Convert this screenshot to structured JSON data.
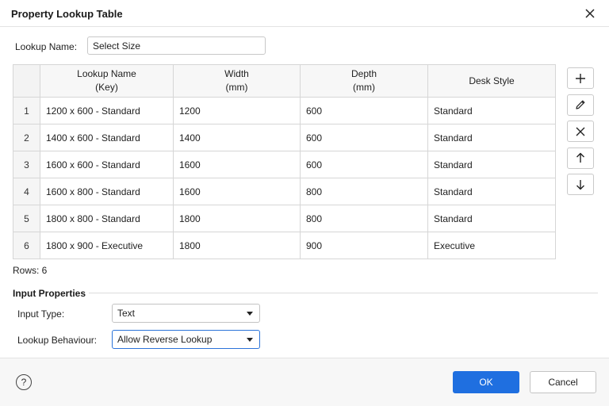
{
  "window": {
    "title": "Property Lookup Table"
  },
  "lookup_name": {
    "label": "Lookup Name:",
    "value": "Select Size"
  },
  "table": {
    "headers": [
      {
        "line1": "",
        "line2": ""
      },
      {
        "line1": "Lookup Name",
        "line2": "(Key)"
      },
      {
        "line1": "Width",
        "line2": "(mm)"
      },
      {
        "line1": "Depth",
        "line2": "(mm)"
      },
      {
        "line1": "Desk Style",
        "line2": ""
      }
    ],
    "rows": [
      {
        "num": "1",
        "key": "1200 x 600 - Standard",
        "width": "1200",
        "depth": "600",
        "style": "Standard"
      },
      {
        "num": "2",
        "key": "1400 x 600 - Standard",
        "width": "1400",
        "depth": "600",
        "style": "Standard"
      },
      {
        "num": "3",
        "key": "1600 x 600 - Standard",
        "width": "1600",
        "depth": "600",
        "style": "Standard"
      },
      {
        "num": "4",
        "key": "1600 x 800 - Standard",
        "width": "1600",
        "depth": "800",
        "style": "Standard"
      },
      {
        "num": "5",
        "key": "1800 x 800 - Standard",
        "width": "1800",
        "depth": "800",
        "style": "Standard"
      },
      {
        "num": "6",
        "key": "1800 x 900 - Executive",
        "width": "1800",
        "depth": "900",
        "style": "Executive"
      }
    ],
    "rows_count_label": "Rows: 6"
  },
  "side_toolbar": {
    "icons": [
      "add-icon",
      "edit-icon",
      "delete-icon",
      "move-up-icon",
      "move-down-icon"
    ]
  },
  "input_properties": {
    "section_title": "Input Properties",
    "input_type_label": "Input Type:",
    "input_type_value": "Text",
    "lookup_behaviour_label": "Lookup Behaviour:",
    "lookup_behaviour_value": "Allow Reverse Lookup"
  },
  "footer": {
    "help_glyph": "?",
    "ok_label": "OK",
    "cancel_label": "Cancel"
  },
  "colors": {
    "accent": "#1f6fe0",
    "focus": "#2b73d9"
  }
}
